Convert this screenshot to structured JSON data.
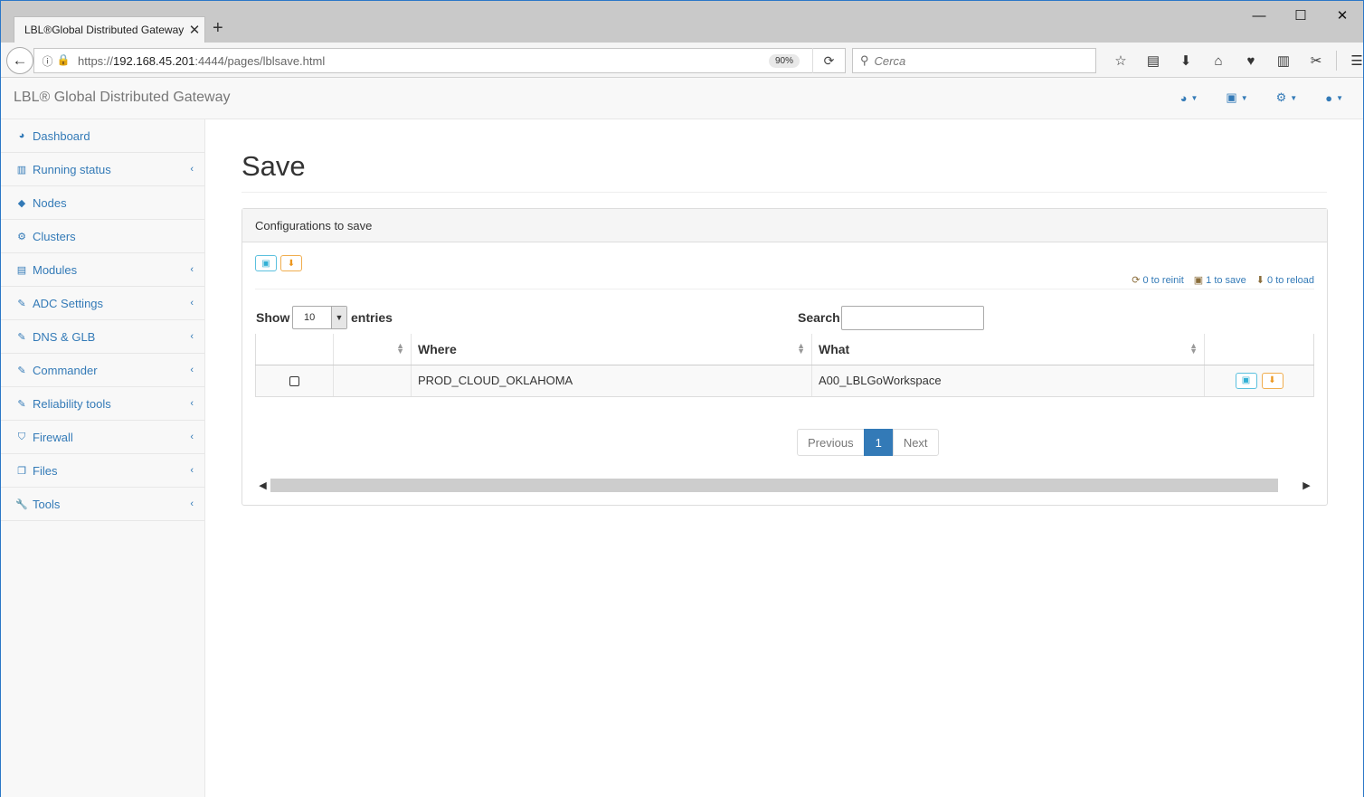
{
  "browser": {
    "tab_title": "LBL®Global Distributed Gateway",
    "tab_close": "✕",
    "new_tab": "+",
    "win_minimize": "—",
    "win_maximize": "☐",
    "win_close": "✕",
    "url_prefix": "https://",
    "url_host": "192.168.45.201",
    "url_rest": ":4444/pages/lblsave.html",
    "zoom": "90%",
    "search_placeholder": "Cerca"
  },
  "header": {
    "brand": "LBL® Global Distributed Gateway",
    "menus": [
      {
        "icon": "dashboard-icon"
      },
      {
        "icon": "save-icon"
      },
      {
        "icon": "gear-icon"
      },
      {
        "icon": "user-icon"
      }
    ]
  },
  "sidebar": {
    "items": [
      {
        "label": "Dashboard",
        "icon": "dashboard-icon",
        "has_submenu": false
      },
      {
        "label": "Running status",
        "icon": "bar-chart-icon",
        "has_submenu": true
      },
      {
        "label": "Nodes",
        "icon": "cube-icon",
        "has_submenu": false
      },
      {
        "label": "Clusters",
        "icon": "cogs-icon",
        "has_submenu": false
      },
      {
        "label": "Modules",
        "icon": "list-icon",
        "has_submenu": true
      },
      {
        "label": "ADC Settings",
        "icon": "edit-icon",
        "has_submenu": true
      },
      {
        "label": "DNS & GLB",
        "icon": "edit-icon",
        "has_submenu": true
      },
      {
        "label": "Commander",
        "icon": "edit-icon",
        "has_submenu": true
      },
      {
        "label": "Reliability tools",
        "icon": "edit-icon",
        "has_submenu": true
      },
      {
        "label": "Firewall",
        "icon": "shield-icon",
        "has_submenu": true
      },
      {
        "label": "Files",
        "icon": "files-icon",
        "has_submenu": true
      },
      {
        "label": "Tools",
        "icon": "wrench-icon",
        "has_submenu": true
      }
    ]
  },
  "main": {
    "title": "Save",
    "panel_title": "Configurations to save",
    "counters": {
      "reinit": "0 to reinit",
      "save": "1 to save",
      "reload": "0 to reload"
    },
    "show_label": "Show",
    "page_size": "10",
    "entries_label": "entries",
    "search_label": "Search:",
    "search_value": "",
    "columns": [
      "",
      "",
      "Where",
      "What",
      ""
    ],
    "rows": [
      {
        "where": "PROD_CLOUD_OKLAHOMA",
        "what": "A00_LBLGoWorkspace",
        "checked": false
      }
    ],
    "pagination": {
      "previous": "Previous",
      "current": "1",
      "next": "Next"
    }
  },
  "colors": {
    "link": "#337ab7",
    "info": "#5bc0de",
    "warning": "#f0ad4e"
  }
}
